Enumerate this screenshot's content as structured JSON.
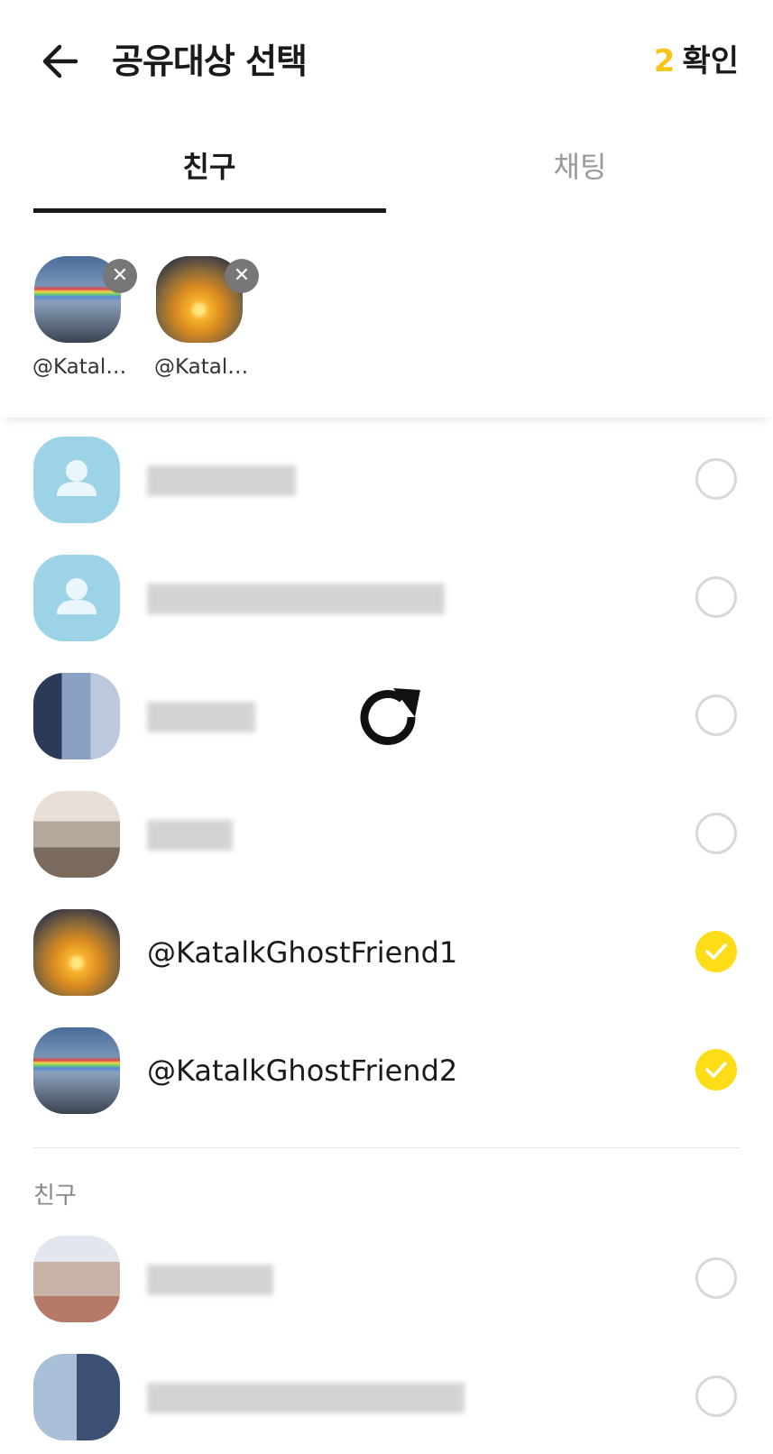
{
  "header": {
    "title": "공유대상 선택",
    "selected_count": "2",
    "confirm_label": "확인"
  },
  "tabs": [
    {
      "label": "친구",
      "active": true
    },
    {
      "label": "채팅",
      "active": false
    }
  ],
  "selected": [
    {
      "label": "@Katal…",
      "remove_icon": "close-icon"
    },
    {
      "label": "@Katal…",
      "remove_icon": "close-icon"
    }
  ],
  "friends": [
    {
      "name": "",
      "checked": false
    },
    {
      "name": "",
      "checked": false
    },
    {
      "name": "",
      "checked": false
    },
    {
      "name": "",
      "checked": false
    },
    {
      "name": "@KatalkGhostFriend1",
      "checked": true
    },
    {
      "name": "@KatalkGhostFriend2",
      "checked": true
    }
  ],
  "section_label": "친구",
  "friends_more": [
    {
      "name": "",
      "checked": false
    },
    {
      "name": "",
      "checked": false
    }
  ],
  "colors": {
    "accent": "#fedd18",
    "count": "#f5c518"
  }
}
